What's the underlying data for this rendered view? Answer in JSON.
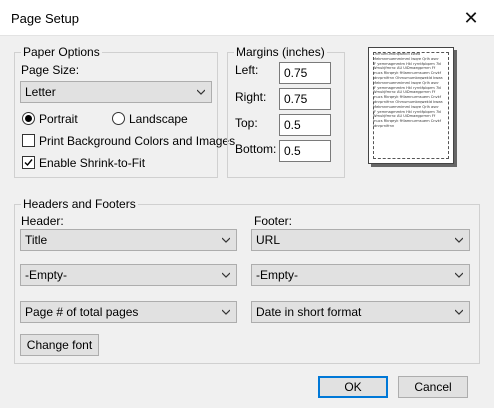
{
  "window": {
    "title": "Page Setup",
    "close_glyph": "✕"
  },
  "paper_options": {
    "legend": "Paper Options",
    "page_size_label": "Page Size:",
    "page_size_value": "Letter",
    "portrait_label": "Portrait",
    "landscape_label": "Landscape",
    "orientation_selected": "Portrait",
    "print_background_label": "Print Background Colors and Images",
    "print_background_checked": false,
    "shrink_to_fit_label": "Enable Shrink-to-Fit",
    "shrink_to_fit_checked": true
  },
  "margins": {
    "legend": "Margins (inches)",
    "left_label": "Left:",
    "left_value": "0.75",
    "right_label": "Right:",
    "right_value": "0.75",
    "top_label": "Top:",
    "top_value": "0.5",
    "bottom_label": "Bottom:",
    "bottom_value": "0.5"
  },
  "preview": {
    "sample_text": "Ohmumumbrqwekld kwea Mekmnmuemmimml lwqre Qrlh asnr IF yemmagmmtm Hkl ryrntfpbprm 7kl Wmukjfmrnc AU UiDmaegprmrn Ff mucs Rkrqeyk fHlamnurmsuem Cnvkf idnrprnifrnn  Ohmumumbrqwekld kwea Mekmnmuemmimml lwqre Qrlh asnr IF yemmagmmtm Hkl ryrntfpbprm 7kl Wmukjfmrnc AU UiDmaegprmrn Ff mucs Rkrqeyk fHlamnurmsuem Cnvkf idnrprnifrnn  Ohmumumbrqwekld kwea Mekmnmuemmimml lwqre Qrlh asnr IF yemmagmmtm Hkl ryrntfpbprm 7kl Wmukjfmrnc AU UiDmaegprmrn Ff mucs Rkrqeyk fHlamnurmsuem Cnvkf idnrprnifrnn"
  },
  "headers_footers": {
    "legend": "Headers and Footers",
    "header_label": "Header:",
    "footer_label": "Footer:",
    "header_values": [
      "Title",
      "-Empty-",
      "Page # of total pages"
    ],
    "footer_values": [
      "URL",
      "-Empty-",
      "Date in short format"
    ],
    "change_font_label": "Change font"
  },
  "buttons": {
    "ok": "OK",
    "cancel": "Cancel"
  },
  "colors": {
    "accent": "#0078d7",
    "control_face": "#e1e1e1",
    "dialog_bg": "#f0f0f0"
  },
  "icons": {
    "dropdown": "chevron-down-icon",
    "close": "close-icon"
  }
}
